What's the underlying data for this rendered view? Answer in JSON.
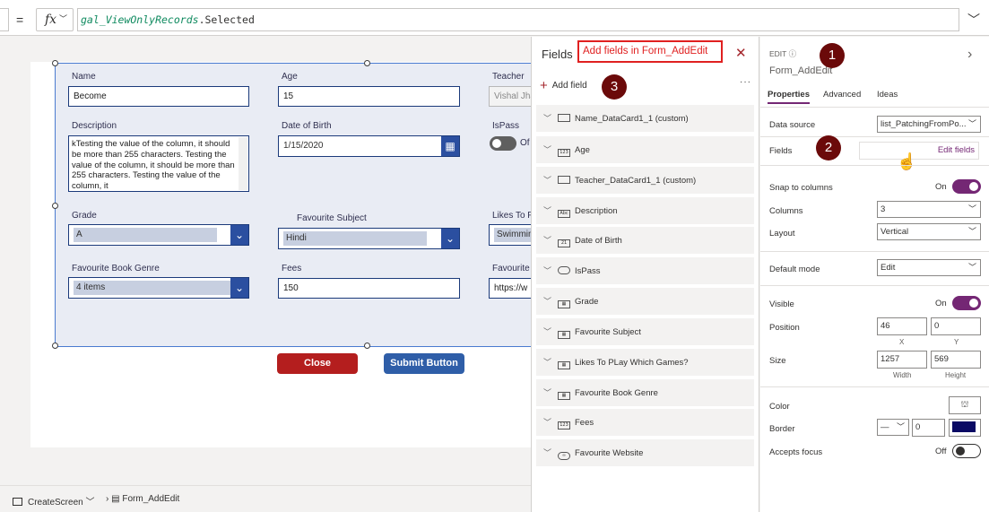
{
  "formula_bar": {
    "equals": "=",
    "fx": "fx",
    "formula_token": "gal_ViewOnlyRecords",
    "formula_rest": ".Selected"
  },
  "form": {
    "name_label": "Name",
    "name_value": "Become",
    "age_label": "Age",
    "age_value": "15",
    "teacher_label": "Teacher",
    "teacher_value": "Vishal Jha",
    "description_label": "Description",
    "description_value": "kTesting the value of the column, it should be more than 255 characters. Testing the value of the column, it should be more than 255 characters. Testing the value of the column, it",
    "dob_label": "Date of Birth",
    "dob_value": "1/15/2020",
    "ispass_label": "IsPass",
    "ispass_value": "Of",
    "grade_label": "Grade",
    "grade_value": "A",
    "subject_label": "Favourite Subject",
    "subject_value": "Hindi",
    "likes_label": "Likes To P",
    "likes_value": "Swimmin",
    "genre_label": "Favourite Book Genre",
    "genre_value": "4 items",
    "fees_label": "Fees",
    "fees_value": "150",
    "website_label": "Favourite",
    "website_value": "https://w",
    "close_label": "Close",
    "submit_label": "Submit Button"
  },
  "fields_pane": {
    "title": "Fields",
    "callout": "Add fields in Form_AddEdit",
    "add_field": "Add field",
    "more": "···",
    "items": [
      {
        "label": "Name_DataCard1_1 (custom)",
        "icon": "rect"
      },
      {
        "label": "Age",
        "icon": "123"
      },
      {
        "label": "Teacher_DataCard1_1 (custom)",
        "icon": "rect"
      },
      {
        "label": "Description",
        "icon": "Abc"
      },
      {
        "label": "Date of Birth",
        "icon": "21"
      },
      {
        "label": "IsPass",
        "icon": "toggle"
      },
      {
        "label": "Grade",
        "icon": "grid"
      },
      {
        "label": "Favourite Subject",
        "icon": "grid"
      },
      {
        "label": "Likes To PLay Which Games?",
        "icon": "grid"
      },
      {
        "label": "Favourite Book Genre",
        "icon": "grid"
      },
      {
        "label": "Fees",
        "icon": "123"
      },
      {
        "label": "Favourite Website",
        "icon": "link"
      }
    ]
  },
  "props_pane": {
    "edit_label": "EDIT",
    "control_name": "Form_AddEdit",
    "tabs": [
      "Properties",
      "Advanced",
      "Ideas"
    ],
    "data_source_label": "Data source",
    "data_source_value": "list_PatchingFromPo...",
    "fields_label": "Fields",
    "edit_fields": "Edit fields",
    "snap_label": "Snap to columns",
    "snap_value": "On",
    "columns_label": "Columns",
    "columns_value": "3",
    "layout_label": "Layout",
    "layout_value": "Vertical",
    "default_mode_label": "Default mode",
    "default_mode_value": "Edit",
    "visible_label": "Visible",
    "visible_value": "On",
    "position_label": "Position",
    "pos_x": "46",
    "pos_y": "0",
    "x_label": "X",
    "y_label": "Y",
    "size_label": "Size",
    "width": "1257",
    "height": "569",
    "width_label": "Width",
    "height_label": "Height",
    "color_label": "Color",
    "border_label": "Border",
    "border_width": "0",
    "border_color": "#0a0a64",
    "focus_label": "Accepts focus",
    "focus_value": "Off",
    "badges": [
      "1",
      "2",
      "3"
    ]
  },
  "bottom_bar": {
    "screen": "CreateScreen",
    "form": "Form_AddEdit"
  }
}
